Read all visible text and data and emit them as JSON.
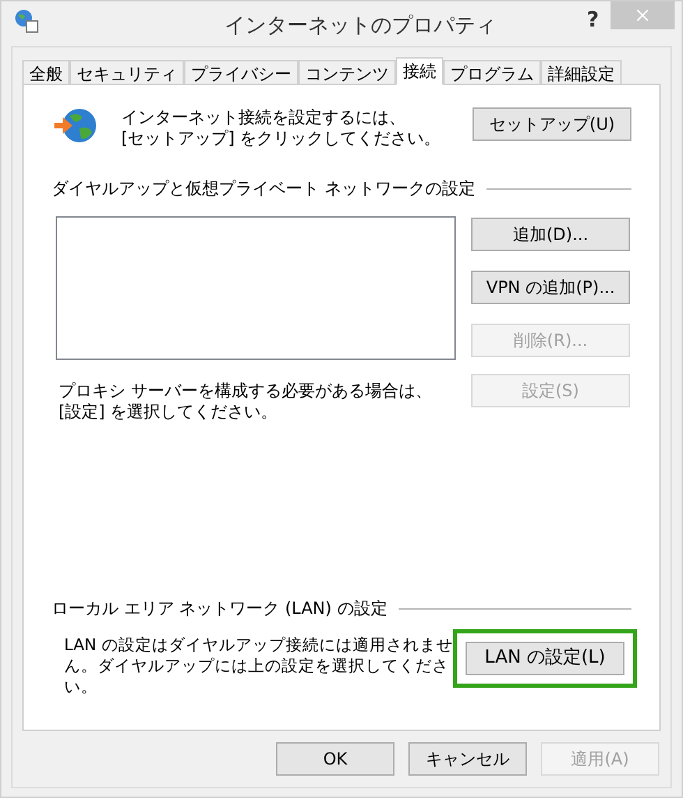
{
  "window": {
    "title": "インターネットのプロパティ",
    "help": "?"
  },
  "tabs": [
    {
      "label": "全般",
      "selected": false
    },
    {
      "label": "セキュリティ",
      "selected": false
    },
    {
      "label": "プライバシー",
      "selected": false
    },
    {
      "label": "コンテンツ",
      "selected": false
    },
    {
      "label": "接続",
      "selected": true
    },
    {
      "label": "プログラム",
      "selected": false
    },
    {
      "label": "詳細設定",
      "selected": false
    }
  ],
  "setup": {
    "text": "インターネット接続を設定するには、\n[セットアップ] をクリックしてください。",
    "button": {
      "label": "セットアップ(U)",
      "disabled": false
    }
  },
  "dialup": {
    "title": "ダイヤルアップと仮想プライベート ネットワークの設定",
    "buttons": [
      {
        "label": "追加(D)...",
        "disabled": false
      },
      {
        "label": "VPN の追加(P)...",
        "disabled": false
      },
      {
        "label": "削除(R)...",
        "disabled": true
      }
    ],
    "proxy_text": "プロキシ サーバーを構成する必要がある場合は、\n[設定] を選択してください。",
    "proxy_button": {
      "label": "設定(S)",
      "disabled": true
    }
  },
  "lan": {
    "title": "ローカル エリア ネットワーク (LAN) の設定",
    "text": "LAN の設定はダイヤルアップ接続には適用されません。ダイヤルアップには上の設定を選択してください。",
    "button": {
      "label": "LAN の設定(L)",
      "disabled": false,
      "highlighted": true
    }
  },
  "footer": [
    {
      "label": "OK",
      "disabled": false
    },
    {
      "label": "キャンセル",
      "disabled": false
    },
    {
      "label": "適用(A)",
      "disabled": true
    }
  ]
}
